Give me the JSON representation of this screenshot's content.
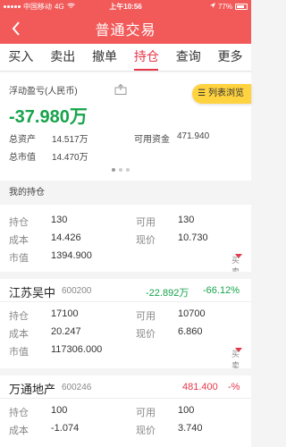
{
  "status": {
    "carrier": "中国移动",
    "network": "4G",
    "time": "上午10:56",
    "battery": "77%"
  },
  "nav": {
    "title": "普通交易"
  },
  "tabs": [
    {
      "label": "买入"
    },
    {
      "label": "卖出"
    },
    {
      "label": "撤单"
    },
    {
      "label": "持仓"
    },
    {
      "label": "查询"
    },
    {
      "label": "更多"
    }
  ],
  "summary": {
    "floating_pl_label": "浮动盈亏(人民币)",
    "floating_pl_value": "-37.980万",
    "list_view_label": "列表浏览",
    "total_assets_label": "总资产",
    "total_assets_value": "14.517万",
    "available_funds_label": "可用资金",
    "available_funds_value": "471.940",
    "total_market_value_label": "总市值",
    "total_market_value_value": "14.470万"
  },
  "holdings_title": "我的持仓",
  "holdings": [
    {
      "name": "",
      "code": "",
      "pl_amount": "",
      "pl_percent": "",
      "position_label": "持仓",
      "position": "130",
      "available_label": "可用",
      "available": "130",
      "cost_label": "成本",
      "cost": "14.426",
      "price_label": "现价",
      "price": "10.730",
      "market_value_label": "市值",
      "market_value": "1394.900",
      "action_label": "买卖操作"
    },
    {
      "name": "江苏吴中",
      "code": "600200",
      "pl_amount": "-22.892万",
      "pl_percent": "-66.12%",
      "position_label": "持仓",
      "position": "17100",
      "available_label": "可用",
      "available": "10700",
      "cost_label": "成本",
      "cost": "20.247",
      "price_label": "现价",
      "price": "6.860",
      "market_value_label": "市值",
      "market_value": "117306.000",
      "action_label": "买卖操作"
    },
    {
      "name": "万通地产",
      "code": "600246",
      "pl_amount": "481.400",
      "pl_percent": "-%",
      "position_label": "持仓",
      "position": "100",
      "available_label": "可用",
      "available": "100",
      "cost_label": "成本",
      "cost": "-1.074",
      "price_label": "现价",
      "price": "3.740"
    }
  ],
  "colors": {
    "brand": "#f25a5a",
    "active_tab": "#e5384a",
    "loss": "#16a34a",
    "gain": "#e5384a",
    "list_button": "#ffd23f"
  }
}
